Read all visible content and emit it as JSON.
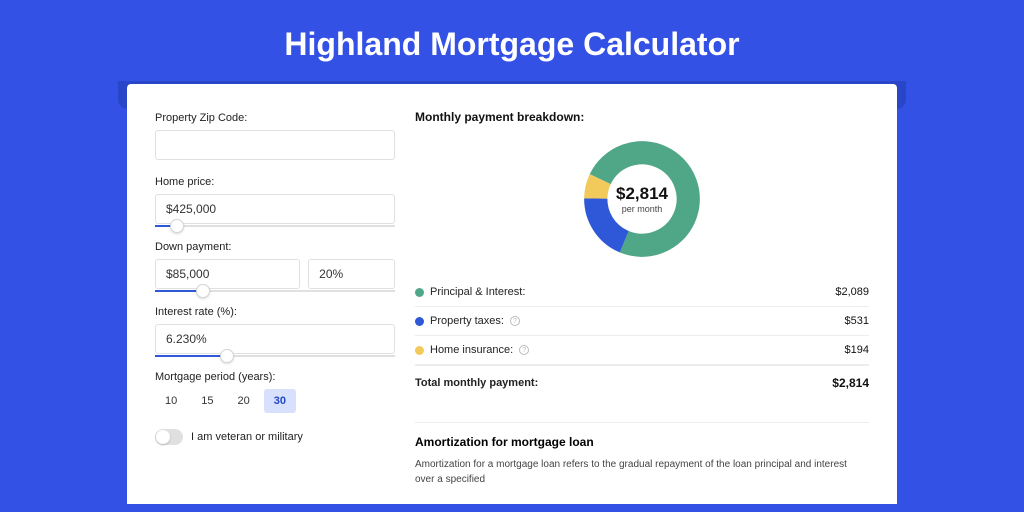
{
  "title": "Highland Mortgage Calculator",
  "form": {
    "zip": {
      "label": "Property Zip Code:",
      "value": ""
    },
    "home_price": {
      "label": "Home price:",
      "value": "$425,000",
      "slider_pct": 9
    },
    "down_payment": {
      "label": "Down payment:",
      "amount": "$85,000",
      "pct": "20%",
      "slider_pct": 20
    },
    "interest_rate": {
      "label": "Interest rate (%):",
      "value": "6.230%",
      "slider_pct": 30
    },
    "period": {
      "label": "Mortgage period (years):",
      "options": [
        "10",
        "15",
        "20",
        "30"
      ],
      "selected": "30"
    },
    "veteran": {
      "label": "I am veteran or military",
      "checked": false
    }
  },
  "breakdown": {
    "title": "Monthly payment breakdown:",
    "center_amount": "$2,814",
    "center_sub": "per month",
    "rows": [
      {
        "label": "Principal & Interest:",
        "value": "$2,089",
        "color": "#4FA788",
        "info": false
      },
      {
        "label": "Property taxes:",
        "value": "$531",
        "color": "#2E58D8",
        "info": true
      },
      {
        "label": "Home insurance:",
        "value": "$194",
        "color": "#F2CA5B",
        "info": true
      }
    ],
    "total": {
      "label": "Total monthly payment:",
      "value": "$2,814"
    }
  },
  "chart_data": {
    "type": "pie",
    "title": "Monthly payment breakdown",
    "series": [
      {
        "name": "Principal & Interest",
        "value": 2089,
        "color": "#4FA788"
      },
      {
        "name": "Property taxes",
        "value": 531,
        "color": "#2E58D8"
      },
      {
        "name": "Home insurance",
        "value": 194,
        "color": "#F2CA5B"
      }
    ],
    "total": 2814,
    "center_label": "$2,814 per month"
  },
  "amortization": {
    "title": "Amortization for mortgage loan",
    "text": "Amortization for a mortgage loan refers to the gradual repayment of the loan principal and interest over a specified"
  }
}
